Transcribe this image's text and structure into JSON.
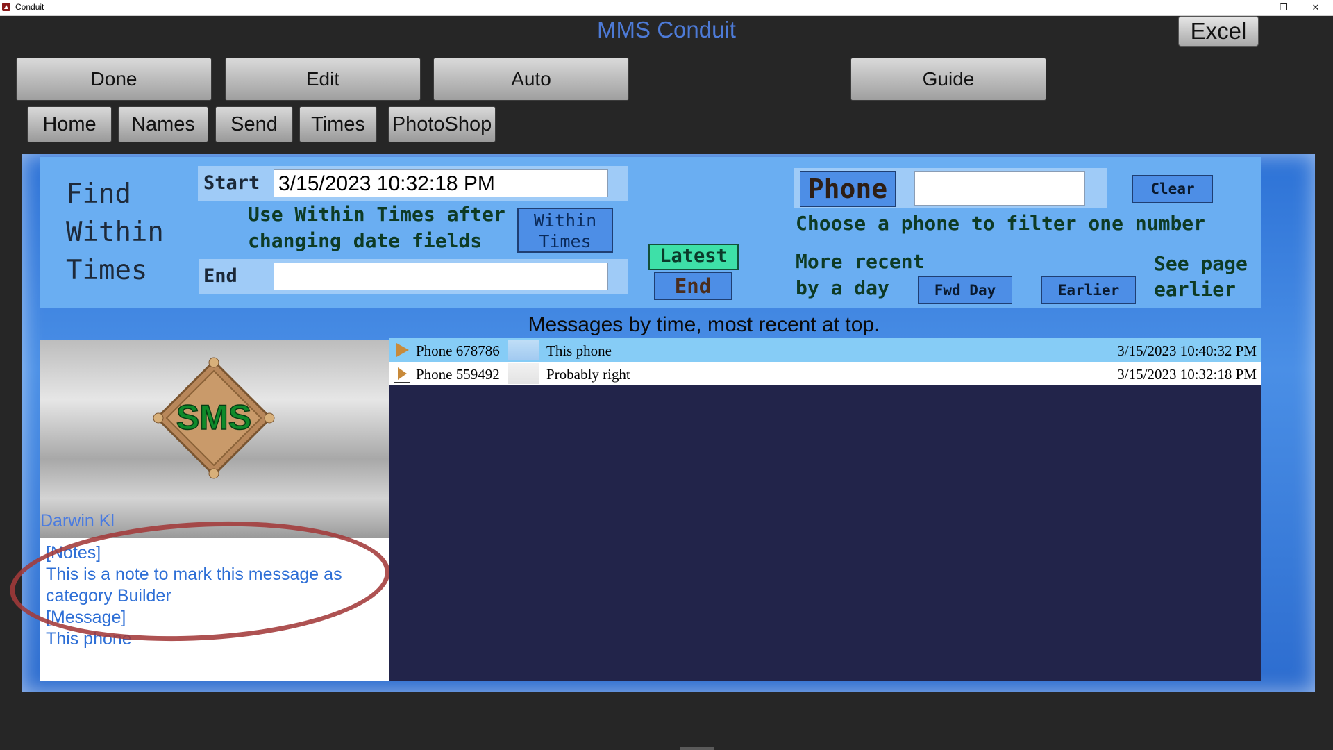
{
  "window": {
    "title": "Conduit",
    "minimize": "–",
    "restore": "❐",
    "close": "✕"
  },
  "header": {
    "app_title": "MMS Conduit",
    "excel_label": "Excel"
  },
  "toolbar": {
    "done": "Done",
    "edit": "Edit",
    "auto": "Auto",
    "guide": "Guide"
  },
  "nav": {
    "home": "Home",
    "names": "Names",
    "send": "Send",
    "times": "Times",
    "photoshop": "PhotoShop"
  },
  "find": {
    "title_line1": "Find",
    "title_line2": "Within",
    "title_line3": "Times",
    "start_label": "Start",
    "start_value": "3/15/2023 10:32:18 PM",
    "end_label": "End",
    "end_value": "",
    "hint_line1": "Use Within Times after",
    "hint_line2": "changing date fields",
    "within_line1": "Within",
    "within_line2": "Times",
    "latest": "Latest",
    "end_button": "End"
  },
  "phone_filter": {
    "label": "Phone",
    "value": "",
    "clear": "Clear",
    "hint": "Choose a phone to filter one number",
    "recent_line1": "More recent",
    "recent_line2": "by a day",
    "fwd_day": "Fwd Day",
    "earlier": "Earlier",
    "seepage_line1": "See page",
    "seepage_line2": "earlier"
  },
  "messages": {
    "heading": "Messages by time, most recent at top.",
    "rows": [
      {
        "phone": "Phone 678786",
        "text": "This phone",
        "time": "3/15/2023 10:40:32 PM",
        "selected": true
      },
      {
        "phone": "Phone 559492",
        "text": "Probably right",
        "time": "3/15/2023 10:32:18 PM",
        "selected": false
      }
    ]
  },
  "detail": {
    "logo_text": "SMS",
    "user_name": "Darwin Kl",
    "notes_tag": "[Notes]",
    "note_line1": "This is a note to mark this message as",
    "note_line2": "category Builder",
    "message_tag": "[Message]",
    "message_text": "This phone"
  },
  "colors": {
    "accent": "#4d7ad6",
    "panel": "#6aaef2",
    "list_bg": "#22244a",
    "highlight_ring": "#a33a3a"
  }
}
